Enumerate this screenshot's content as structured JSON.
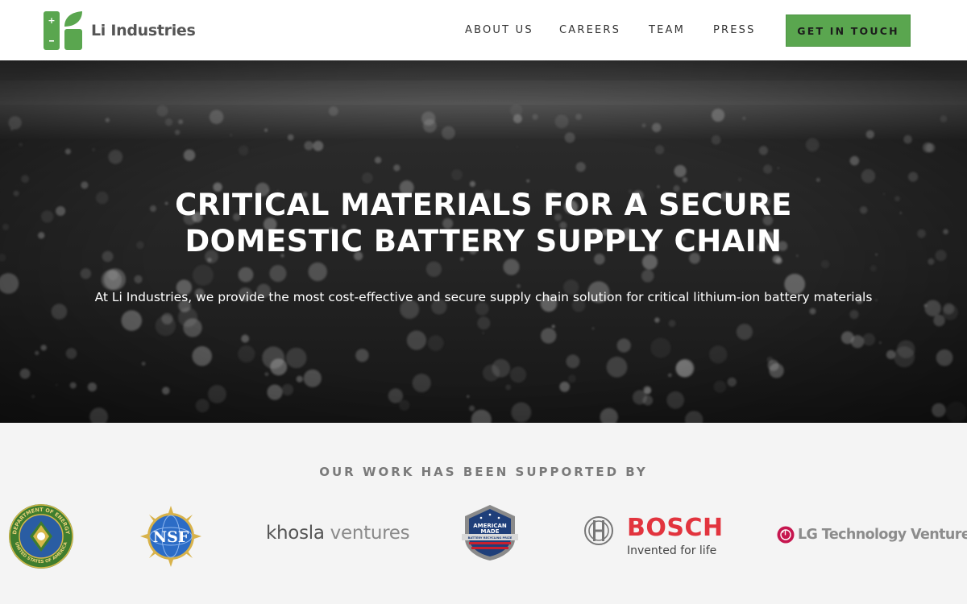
{
  "brand": {
    "name": "Li Industries",
    "accent": "#5aa64f"
  },
  "nav": {
    "items": [
      {
        "label": "ABOUT US"
      },
      {
        "label": "CAREERS"
      },
      {
        "label": "TEAM"
      },
      {
        "label": "PRESS"
      }
    ],
    "cta_label": "GET IN TOUCH"
  },
  "hero": {
    "title_line1": "CRITICAL MATERIALS FOR A SECURE",
    "title_line2": "DOMESTIC BATTERY SUPPLY CHAIN",
    "subtitle": "At Li Industries, we provide the most cost-effective and secure supply chain solution for critical lithium-ion battery materials"
  },
  "supporters": {
    "heading": "OUR WORK HAS BEEN SUPPORTED BY",
    "doe_ring_top": "DEPARTMENT OF ENERGY",
    "doe_ring_bottom": "UNITED STATES OF AMERICA",
    "nsf": "NSF",
    "khosla_a": "khosla",
    "khosla_b": "ventures",
    "american_made_1": "AMERICAN",
    "american_made_2": "MADE",
    "american_made_3": "BATTERY RECYCLING PRIZE",
    "bosch": "BOSCH",
    "bosch_tagline": "Invented for life",
    "lg": "LG Technology Ventures"
  },
  "colors": {
    "bosch_red": "#e2343e",
    "lg_red": "#c6164f",
    "doe_green": "#3f7d2e"
  }
}
